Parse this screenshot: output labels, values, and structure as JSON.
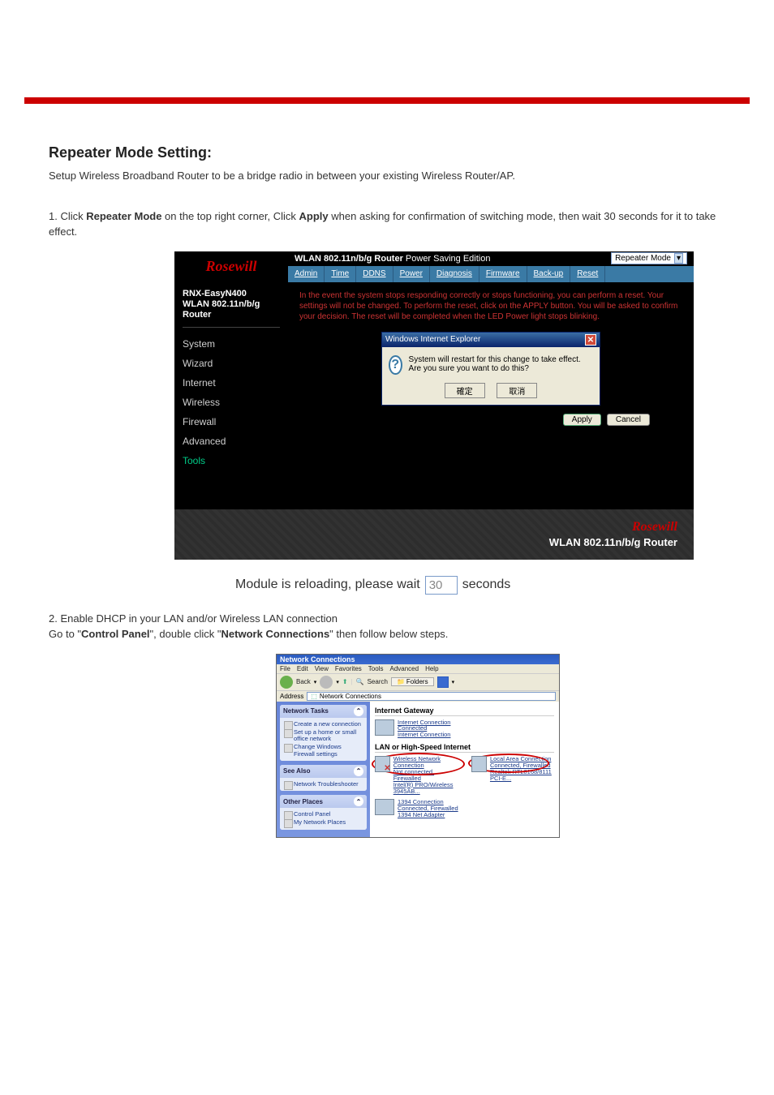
{
  "section": {
    "title": "Repeater Mode Setting:",
    "intro": "Setup Wireless Broadband Router to be a bridge radio in between your existing Wireless Router/AP.",
    "step1_prefix": "1. Click ",
    "step1_bold": "Repeater Mode",
    "step1_mid": " on the top right corner, Click ",
    "step1_bold2": "Apply",
    "step1_after": " when asking for confirmation of switching mode, then wait 30 seconds for it to take effect.",
    "step2": "2. Enable DHCP in your LAN and/or Wireless LAN connection",
    "step2_path_prefix": "Go to \"",
    "step2_path_bold": "Control Panel",
    "step2_path_mid": "\", double click \"",
    "step2_path_bold2": "Network Connections",
    "step2_path_after": "\" then follow below steps."
  },
  "router": {
    "logo": "Rosewill",
    "title_main": "WLAN 802.11n/b/g Router",
    "title_sub": " Power Saving Edition",
    "mode_select": "Repeater Mode",
    "tabs": [
      "Admin",
      "Time",
      "DDNS",
      "Power",
      "Diagnosis",
      "Firmware",
      "Back-up",
      "Reset"
    ],
    "product_line1": "RNX-EasyN400",
    "product_line2": "WLAN 802.11n/b/g Router",
    "nav": [
      "System",
      "Wizard",
      "Internet",
      "Wireless",
      "Firewall",
      "Advanced",
      "Tools"
    ],
    "nav_active": "Tools",
    "reset_text": "In the event the system stops responding correctly or stops functioning, you can perform a reset. Your settings will not be changed. To perform the reset, click on the APPLY button. You will be asked to confirm your decision. The reset will be completed when the LED Power light stops blinking.",
    "ie_title": "Windows Internet Explorer",
    "ie_msg": "System will restart for this change to take effect. Are you sure you want to do this?",
    "ie_ok": "確定",
    "ie_cancel": "取消",
    "apply": "Apply",
    "cancel": "Cancel",
    "footer_model": "WLAN 802.11n/b/g Router"
  },
  "reloading": {
    "prefix": "Module is reloading, please wait",
    "value": "30",
    "suffix": "seconds"
  },
  "nc": {
    "title": "Network Connections",
    "menus": [
      "File",
      "Edit",
      "View",
      "Favorites",
      "Tools",
      "Advanced",
      "Help"
    ],
    "back": "Back",
    "search": "Search",
    "folders": "Folders",
    "address_label": "Address",
    "address_value": "Network Connections",
    "panel_tasks_title": "Network Tasks",
    "tasks": [
      "Create a new connection",
      "Set up a home or small office network",
      "Change Windows Firewall settings"
    ],
    "panel_seealso_title": "See Also",
    "seealso": [
      "Network Troubleshooter"
    ],
    "panel_other_title": "Other Places",
    "other": [
      "Control Panel",
      "My Network Places"
    ],
    "group1": "Internet Gateway",
    "conn1_name": "Internet Connection",
    "conn1_status": "Connected",
    "conn1_sub": "Internet Connection",
    "group2": "LAN or High-Speed Internet",
    "wlan_name": "Wireless Network Connection",
    "wlan_status": "Not connected, Firewalled",
    "wlan_sub": "Intel(R) PRO/Wireless 3945AB...",
    "lan_name": "Local Area Connection",
    "lan_status": "Connected, Firewalled",
    "lan_sub": "Realtek RTL8168/8111 PCI-E...",
    "c1394_name": "1394 Connection",
    "c1394_status": "Connected, Firewalled",
    "c1394_sub": "1394 Net Adapter"
  }
}
